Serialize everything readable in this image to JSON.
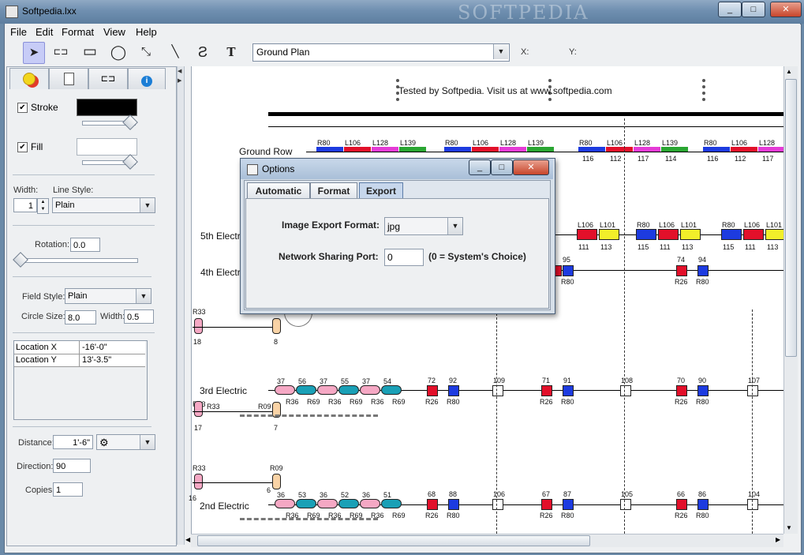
{
  "window": {
    "title": "Softpedia.lxx",
    "min": "_",
    "max": "□",
    "close": "✕",
    "watermark": "SOFTPEDIA"
  },
  "menu": [
    "File",
    "Edit",
    "Format",
    "View",
    "Help"
  ],
  "toolbar": {
    "tools": [
      "select-tool",
      "fixture-tool",
      "rectangle-tool",
      "ellipse-tool",
      "erase-line-tool",
      "line-tool",
      "curve-tool",
      "text-tool"
    ],
    "glyphs": [
      "➤",
      "⊏⊐",
      "▭",
      "◯",
      "⤡",
      "╲",
      "Ƨ",
      "T"
    ],
    "plan": "Ground Plan",
    "x_label": "X:",
    "y_label": "Y:"
  },
  "left_panel": {
    "tabs": [
      "paint-icon",
      "page-icon",
      "fixture-icon",
      "info-icon"
    ],
    "stroke_label": "Stroke",
    "stroke_color": "#000000",
    "fill_label": "Fill",
    "fill_color": "#ffffff",
    "width_label": "Width:",
    "width_value": "1",
    "line_style_label": "Line Style:",
    "line_style_value": "Plain",
    "rotation_label": "Rotation:",
    "rotation_value": "0.0",
    "field_style_label": "Field Style:",
    "field_style_value": "Plain",
    "circle_size_label": "Circle Size:",
    "circle_size_value": "8.0",
    "circle_width_label": "Width:",
    "circle_width_value": "0.5",
    "location_rows": [
      {
        "k": "Location X",
        "v": "-16'-0\""
      },
      {
        "k": "Location Y",
        "v": "13'-3.5\""
      }
    ],
    "distance_label": "Distance:",
    "distance_value": "1'-6\"",
    "direction_label": "Direction:",
    "direction_value": "90",
    "copies_label": "Copies:",
    "copies_value": "1"
  },
  "canvas": {
    "banner": "Tested by Softpedia. Visit us at www.softpedia.com",
    "rows": [
      "Ground Row",
      "5th Electric",
      "4th Electric",
      "3rd Electric",
      "2nd Electric"
    ],
    "ground_labels": [
      "R80",
      "L106",
      "L128",
      "L139"
    ],
    "ground_numbers": [
      "116",
      "112",
      "117",
      "114"
    ],
    "fifth_labels": [
      "R80",
      "L106",
      "L101"
    ],
    "fifth_numbers": [
      "115",
      "111",
      "113"
    ],
    "circuit_r26": "R26",
    "circuit_r80": "R80",
    "circuit_r33": "R33",
    "circuit_r09": "R09",
    "circuit_r36": "R36",
    "circuit_r69": "R69"
  },
  "dialog": {
    "title": "Options",
    "tabs": [
      "Automatic",
      "Format",
      "Export"
    ],
    "format_label": "Image Export Format:",
    "format_value": "jpg",
    "port_label": "Network Sharing Port:",
    "port_value": "0",
    "port_hint": "(0 = System's Choice)"
  }
}
